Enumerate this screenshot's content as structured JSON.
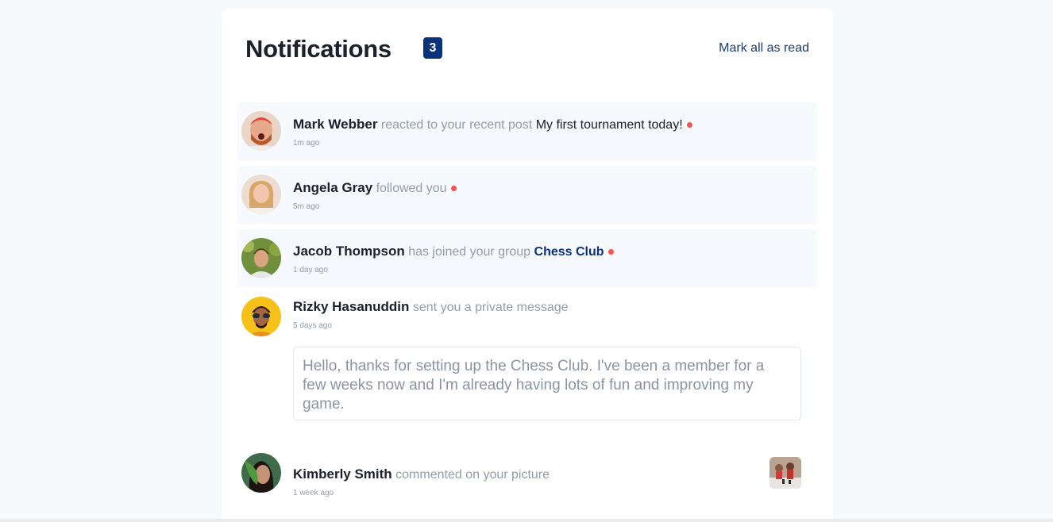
{
  "header": {
    "title": "Notifications",
    "unread_count": "3",
    "mark_all_label": "Mark all as read"
  },
  "notifications": [
    {
      "name": "Mark Webber",
      "action": "reacted to your recent post",
      "target": "My first tournament today!",
      "time": "1m ago",
      "unread": true
    },
    {
      "name": "Angela Gray",
      "action": "followed you",
      "time": "5m ago",
      "unread": true
    },
    {
      "name": "Jacob Thompson",
      "action": "has joined your group",
      "target": "Chess Club",
      "time": "1 day ago",
      "unread": true
    },
    {
      "name": "Rizky Hasanuddin",
      "action": "sent you a private message",
      "time": "5 days ago",
      "message": "Hello, thanks for setting up the Chess Club. I've been a member for a few weeks now and I'm already having lots of fun and improving my game.",
      "unread": false
    },
    {
      "name": "Kimberly Smith",
      "action": "commented on your picture",
      "time": "1 week ago",
      "unread": false
    }
  ],
  "colors": {
    "accent": "#0a327b",
    "unread_dot": "#f65552",
    "unread_bg": "#f6f9fd",
    "muted_text": "#939ca9"
  }
}
